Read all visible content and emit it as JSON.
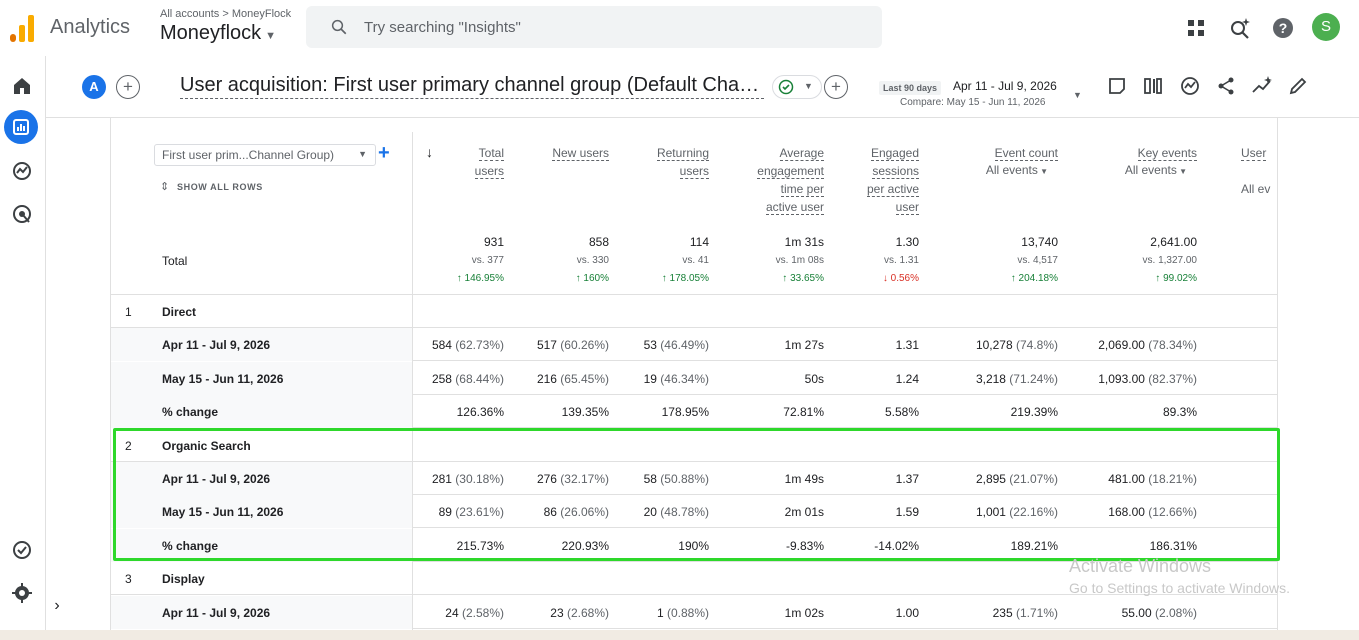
{
  "topbar": {
    "app_name": "Analytics",
    "breadcrumb": "All accounts > MoneyFlock",
    "account": "Moneyflock",
    "search_placeholder": "Try searching \"Insights\"",
    "avatar_letter": "S"
  },
  "report": {
    "comparison_letter": "A",
    "title": "User acquisition: First user primary channel group (Default Channel Group)",
    "date_label": "Last 90 days",
    "date_range": "Apr 11 - Jul 9, 2026",
    "compare_range": "Compare: May 15 - Jun 11, 2026"
  },
  "table": {
    "dimension": "First user prim...Channel Group)",
    "show_all_rows": "SHOW ALL ROWS",
    "columns": [
      {
        "lines": [
          "Total",
          "users"
        ],
        "sub": ""
      },
      {
        "lines": [
          "New users"
        ],
        "sub": ""
      },
      {
        "lines": [
          "Returning",
          "users"
        ],
        "sub": ""
      },
      {
        "lines": [
          "Average",
          "engagement",
          "time per",
          "active user"
        ],
        "sub": ""
      },
      {
        "lines": [
          "Engaged",
          "sessions",
          "per active",
          "user"
        ],
        "sub": ""
      },
      {
        "lines": [
          "Event count"
        ],
        "sub": "All events"
      },
      {
        "lines": [
          "Key events"
        ],
        "sub": "All events"
      },
      {
        "lines": [
          "User"
        ],
        "sub": "All ev"
      }
    ],
    "total": {
      "label": "Total",
      "values": [
        "931",
        "858",
        "114",
        "1m 31s",
        "1.30",
        "13,740",
        "2,641.00"
      ],
      "vs": [
        "vs. 377",
        "vs. 330",
        "vs. 41",
        "vs. 1m 08s",
        "vs. 1.31",
        "vs. 4,517",
        "vs. 1,327.00"
      ],
      "changes": [
        "146.95%",
        "160%",
        "178.05%",
        "33.65%",
        "0.56%",
        "204.18%",
        "99.02%"
      ],
      "change_dir": [
        "up",
        "up",
        "up",
        "up",
        "down",
        "up",
        "up"
      ]
    },
    "rows": [
      {
        "num": "1",
        "label": "Direct",
        "cells": []
      },
      {
        "num": "",
        "label": "Apr 11 - Jul 9, 2026",
        "cells": [
          [
            "584",
            " (62.73%)"
          ],
          [
            "517",
            " (60.26%)"
          ],
          [
            "53",
            " (46.49%)"
          ],
          [
            "1m 27s",
            ""
          ],
          [
            "1.31",
            ""
          ],
          [
            "10,278",
            " (74.8%)"
          ],
          [
            "2,069.00",
            " (78.34%)"
          ]
        ]
      },
      {
        "num": "",
        "label": "May 15 - Jun 11, 2026",
        "cells": [
          [
            "258",
            " (68.44%)"
          ],
          [
            "216",
            " (65.45%)"
          ],
          [
            "19",
            " (46.34%)"
          ],
          [
            "50s",
            ""
          ],
          [
            "1.24",
            ""
          ],
          [
            "3,218",
            " (71.24%)"
          ],
          [
            "1,093.00",
            " (82.37%)"
          ]
        ]
      },
      {
        "num": "",
        "label": "% change",
        "cells": [
          [
            "126.36%",
            ""
          ],
          [
            "139.35%",
            ""
          ],
          [
            "178.95%",
            ""
          ],
          [
            "72.81%",
            ""
          ],
          [
            "5.58%",
            ""
          ],
          [
            "219.39%",
            ""
          ],
          [
            "89.3%",
            ""
          ]
        ]
      },
      {
        "num": "2",
        "label": "Organic Search",
        "cells": []
      },
      {
        "num": "",
        "label": "Apr 11 - Jul 9, 2026",
        "cells": [
          [
            "281",
            " (30.18%)"
          ],
          [
            "276",
            " (32.17%)"
          ],
          [
            "58",
            " (50.88%)"
          ],
          [
            "1m 49s",
            ""
          ],
          [
            "1.37",
            ""
          ],
          [
            "2,895",
            " (21.07%)"
          ],
          [
            "481.00",
            " (18.21%)"
          ]
        ]
      },
      {
        "num": "",
        "label": "May 15 - Jun 11, 2026",
        "cells": [
          [
            "89",
            " (23.61%)"
          ],
          [
            "86",
            " (26.06%)"
          ],
          [
            "20",
            " (48.78%)"
          ],
          [
            "2m 01s",
            ""
          ],
          [
            "1.59",
            ""
          ],
          [
            "1,001",
            " (22.16%)"
          ],
          [
            "168.00",
            " (12.66%)"
          ]
        ]
      },
      {
        "num": "",
        "label": "% change",
        "cells": [
          [
            "215.73%",
            ""
          ],
          [
            "220.93%",
            ""
          ],
          [
            "190%",
            ""
          ],
          [
            "-9.83%",
            ""
          ],
          [
            "-14.02%",
            ""
          ],
          [
            "189.21%",
            ""
          ],
          [
            "186.31%",
            ""
          ]
        ]
      },
      {
        "num": "3",
        "label": "Display",
        "cells": []
      },
      {
        "num": "",
        "label": "Apr 11 - Jul 9, 2026",
        "cells": [
          [
            "24",
            " (2.58%)"
          ],
          [
            "23",
            " (2.68%)"
          ],
          [
            "1",
            " (0.88%)"
          ],
          [
            "1m 02s",
            ""
          ],
          [
            "1.00",
            ""
          ],
          [
            "235",
            " (1.71%)"
          ],
          [
            "55.00",
            " (2.08%)"
          ]
        ]
      }
    ]
  },
  "watermark": {
    "line1": "Activate Windows",
    "line2": "Go to Settings to activate Windows."
  },
  "colors": {
    "accent": "#1a73e8",
    "highlight": "#2ed82b",
    "positive": "#188038",
    "negative": "#d93025"
  }
}
